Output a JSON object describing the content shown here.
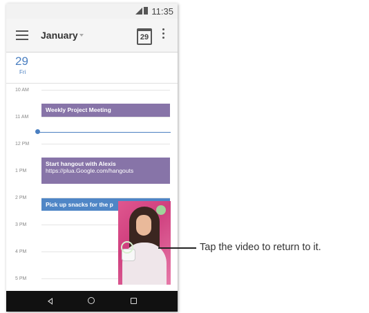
{
  "status_bar": {
    "time": "11:35"
  },
  "app_bar": {
    "month": "January",
    "today_date": "29"
  },
  "day": {
    "number": "29",
    "name": "Fri"
  },
  "hours": [
    "10 AM",
    "11 AM",
    "12 PM",
    "1 PM",
    "2 PM",
    "3 PM",
    "4 PM",
    "5 PM"
  ],
  "events": {
    "meeting": {
      "title": "Weekly Project Meeting",
      "color": "#8774a8"
    },
    "hangout": {
      "title": "Start hangout with Alexis",
      "link": "https://plua.Google.com/hangouts",
      "color": "#8774a8"
    },
    "snacks": {
      "title": "Pick up snacks for the p",
      "color": "#4f86c6"
    }
  },
  "callout": {
    "text": "Tap the video to return to it."
  },
  "colors": {
    "accent": "#4a7fc1",
    "event_purple": "#8774a8",
    "event_blue": "#4f86c6"
  },
  "icons": [
    "menu-icon",
    "chevron-down-icon",
    "calendar-today-icon",
    "overflow-icon",
    "back-icon",
    "home-icon",
    "recents-icon",
    "signal-icon",
    "battery-icon"
  ]
}
